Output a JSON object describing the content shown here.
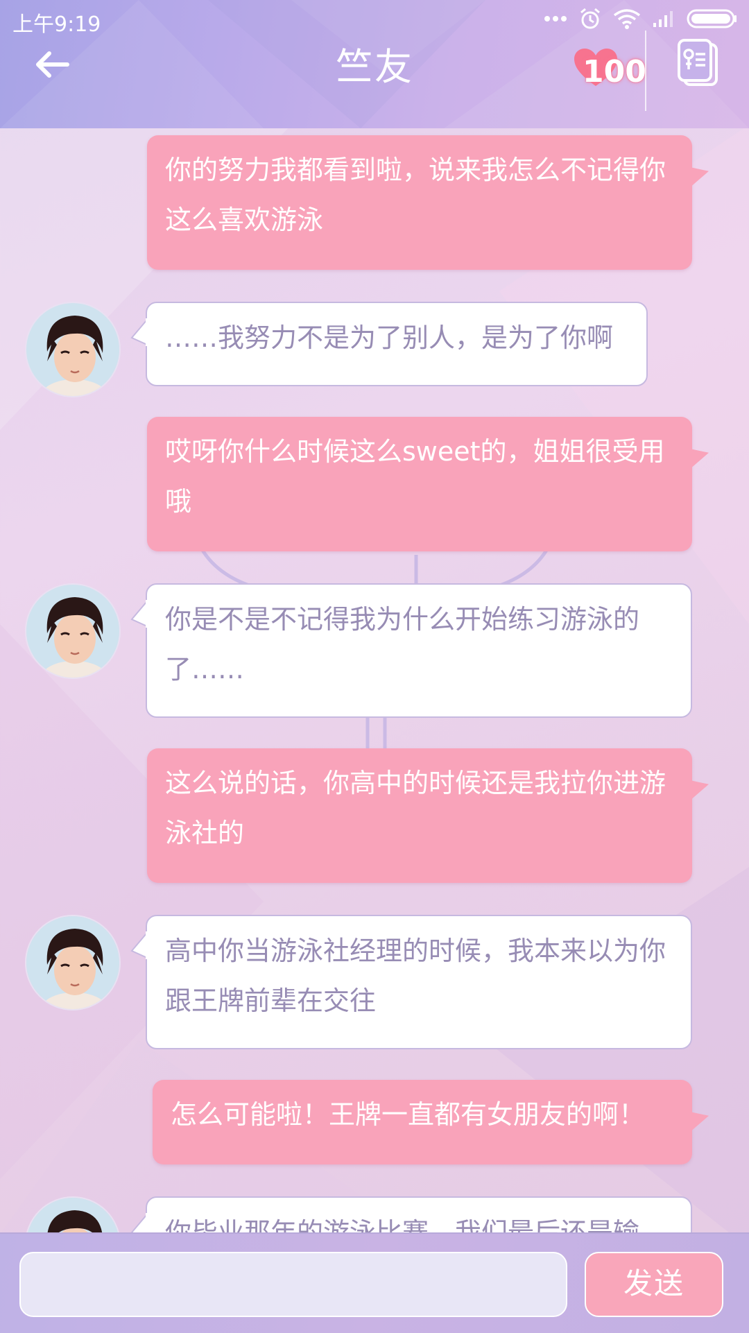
{
  "status_bar": {
    "time": "上午9:19",
    "icons": [
      "dots-icon",
      "alarm-icon",
      "wifi-icon",
      "signal-icon",
      "battery-icon"
    ]
  },
  "header": {
    "title": "竺友",
    "affection_value": "100",
    "icons": [
      "back-arrow-icon",
      "heart-icon",
      "profile-card-icon"
    ]
  },
  "messages": [
    {
      "sender": "me",
      "text": "你的努力我都看到啦，说来我怎么不记得你这么喜欢游泳"
    },
    {
      "sender": "them",
      "text": "……我努力不是为了别人，是为了你啊"
    },
    {
      "sender": "me",
      "text": "哎呀你什么时候这么sweet的，姐姐很受用哦"
    },
    {
      "sender": "them",
      "text": "你是不是不记得我为什么开始练习游泳的了……"
    },
    {
      "sender": "me",
      "text": "这么说的话，你高中的时候还是我拉你进游泳社的"
    },
    {
      "sender": "them",
      "text": "高中你当游泳社经理的时候，我本来以为你跟王牌前辈在交往"
    },
    {
      "sender": "me",
      "text": "怎么可能啦！王牌一直都有女朋友的啊！"
    },
    {
      "sender": "them",
      "text": "你毕业那年的游泳比赛，我们最后还是输"
    }
  ],
  "input": {
    "placeholder": "",
    "send_label": "发送"
  },
  "colors": {
    "my_bubble": "#f9a3ba",
    "their_bubble": "#ffffff",
    "their_text": "#978cb4",
    "header_accent": "#b9aaea"
  }
}
